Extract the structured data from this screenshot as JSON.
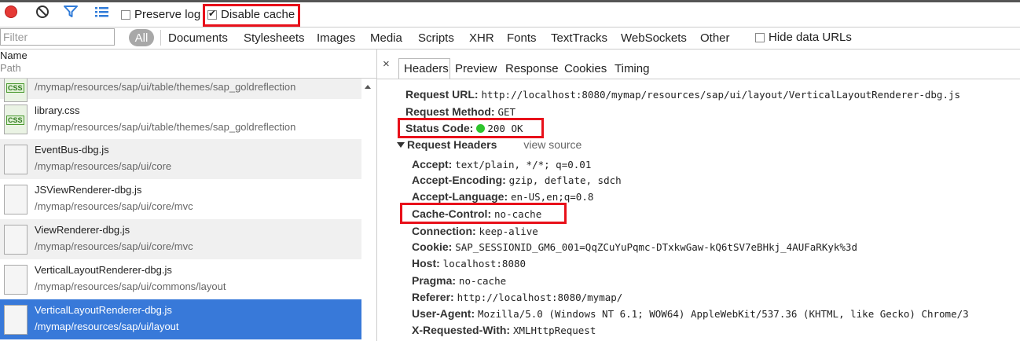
{
  "toolbar": {
    "record_icon": "record-icon",
    "clear_icon": "clear-icon",
    "filter_icon": "filter-icon",
    "overview_icon": "overview-icon",
    "preserve_log": {
      "label": "Preserve log",
      "checked": false
    },
    "disable_cache": {
      "label": "Disable cache",
      "checked": true
    }
  },
  "filterbar": {
    "placeholder": "Filter",
    "all_label": "All",
    "types": [
      "Documents",
      "Stylesheets",
      "Images",
      "Media",
      "Scripts",
      "XHR",
      "Fonts",
      "TextTracks",
      "WebSockets",
      "Other"
    ],
    "hide_data_urls": {
      "label": "Hide data URLs",
      "checked": false
    }
  },
  "columns": {
    "name": "Name",
    "path": "Path"
  },
  "requests": [
    {
      "name": "",
      "path": "/mymap/resources/sap/ui/table/themes/sap_goldreflection",
      "icon": "css",
      "selected": false
    },
    {
      "name": "library.css",
      "path": "/mymap/resources/sap/ui/table/themes/sap_goldreflection",
      "icon": "css",
      "selected": false
    },
    {
      "name": "EventBus-dbg.js",
      "path": "/mymap/resources/sap/ui/core",
      "icon": "file",
      "selected": false
    },
    {
      "name": "JSViewRenderer-dbg.js",
      "path": "/mymap/resources/sap/ui/core/mvc",
      "icon": "file",
      "selected": false
    },
    {
      "name": "ViewRenderer-dbg.js",
      "path": "/mymap/resources/sap/ui/core/mvc",
      "icon": "file",
      "selected": false
    },
    {
      "name": "VerticalLayoutRenderer-dbg.js",
      "path": "/mymap/resources/sap/ui/commons/layout",
      "icon": "file",
      "selected": false
    },
    {
      "name": "VerticalLayoutRenderer-dbg.js",
      "path": "/mymap/resources/sap/ui/layout",
      "icon": "file",
      "selected": true
    }
  ],
  "css_icon_text": "CSS",
  "detail": {
    "close": "×",
    "tabs": [
      "Headers",
      "Preview",
      "Response",
      "Cookies",
      "Timing"
    ],
    "active_tab": "Headers",
    "general": [
      {
        "key": "Request URL:",
        "value": "http://localhost:8080/mymap/resources/sap/ui/layout/VerticalLayoutRenderer-dbg.js"
      },
      {
        "key": "Request Method:",
        "value": "GET"
      },
      {
        "key": "Status Code:",
        "value": "200 OK"
      }
    ],
    "request_headers_title": "Request Headers",
    "view_source": "view source",
    "request_headers": [
      {
        "key": "Accept:",
        "value": "text/plain, */*; q=0.01"
      },
      {
        "key": "Accept-Encoding:",
        "value": "gzip, deflate, sdch"
      },
      {
        "key": "Accept-Language:",
        "value": "en-US,en;q=0.8"
      },
      {
        "key": "Cache-Control:",
        "value": "no-cache"
      },
      {
        "key": "Connection:",
        "value": "keep-alive"
      },
      {
        "key": "Cookie:",
        "value": "SAP_SESSIONID_GM6_001=QqZCuYuPqmc-DTxkwGaw-kQ6tSV7eBHkj_4AUFaRKyk%3d"
      },
      {
        "key": "Host:",
        "value": "localhost:8080"
      },
      {
        "key": "Pragma:",
        "value": "no-cache"
      },
      {
        "key": "Referer:",
        "value": "http://localhost:8080/mymap/"
      },
      {
        "key": "User-Agent:",
        "value": "Mozilla/5.0 (Windows NT 6.1; WOW64) AppleWebKit/537.36 (KHTML, like Gecko) Chrome/3"
      },
      {
        "key": "X-Requested-With:",
        "value": "XMLHttpRequest"
      }
    ]
  },
  "colors": {
    "highlight": "#e8101a",
    "selected_row": "#3879d9",
    "status_ok": "#2ec52e"
  }
}
